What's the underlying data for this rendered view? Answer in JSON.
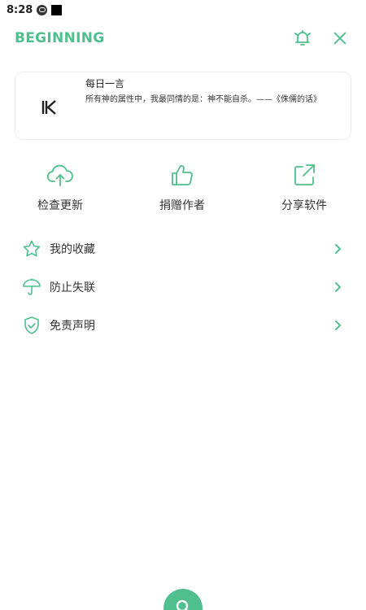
{
  "status_bar": {
    "time": "8:28"
  },
  "header": {
    "title": "BEGINNING",
    "bell_icon": "bell-icon",
    "close_icon": "close-icon"
  },
  "quote": {
    "logo_icon": "k-logo-icon",
    "title": "每日一言",
    "text": "所有神的属性中，我最同情的是：神不能自杀。——《侏儒的话》"
  },
  "actions": [
    {
      "label": "检查更新",
      "icon": "cloud-upload-icon"
    },
    {
      "label": "捐赠作者",
      "icon": "thumbs-up-icon"
    },
    {
      "label": "分享软件",
      "icon": "share-icon"
    }
  ],
  "menu": [
    {
      "label": "我的收藏",
      "icon": "star-icon"
    },
    {
      "label": "防止失联",
      "icon": "umbrella-icon"
    },
    {
      "label": "免责声明",
      "icon": "shield-check-icon"
    }
  ],
  "fab": {
    "icon": "search-icon"
  },
  "colors": {
    "accent": "#4fc08d",
    "text": "#333333",
    "card_border": "#ececec"
  }
}
